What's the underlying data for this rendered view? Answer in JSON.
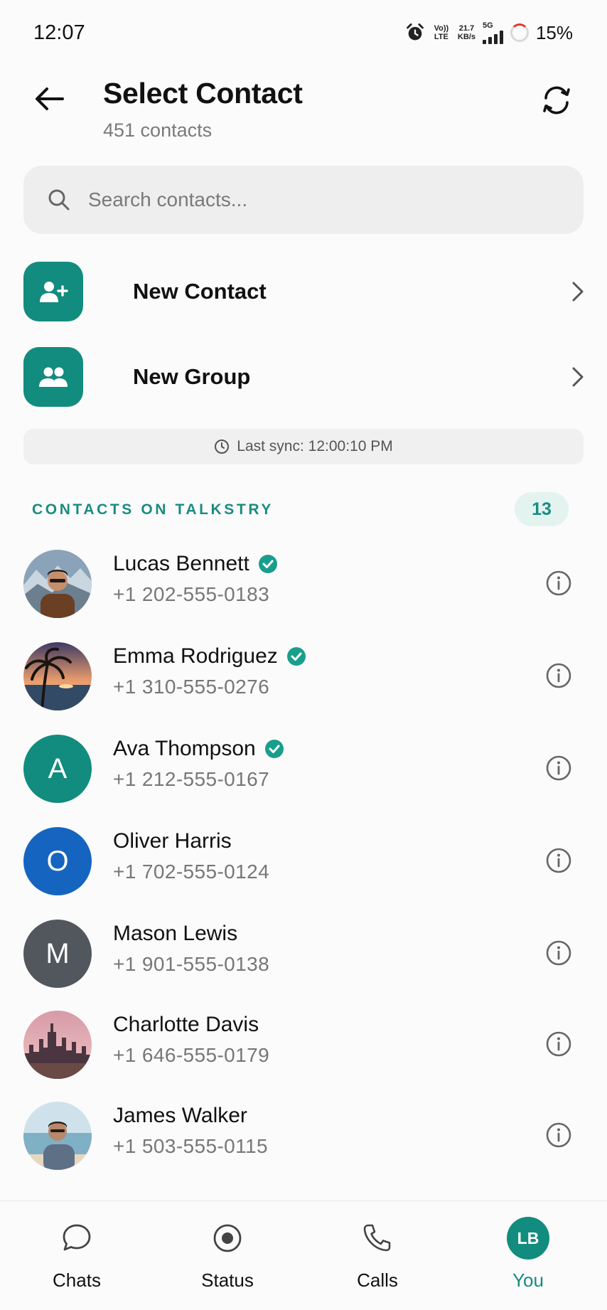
{
  "status_bar": {
    "time": "12:07",
    "volte": "Vo)) LTE",
    "speed_value": "21.7",
    "speed_unit": "KB/s",
    "network": "5G",
    "battery": "15%"
  },
  "header": {
    "title": "Select Contact",
    "subtitle": "451 contacts"
  },
  "search": {
    "placeholder": "Search contacts..."
  },
  "actions": [
    {
      "label": "New Contact",
      "icon": "person-add-icon"
    },
    {
      "label": "New Group",
      "icon": "group-icon"
    }
  ],
  "sync": {
    "text": "Last sync: 12:00:10 PM"
  },
  "section": {
    "title": "CONTACTS ON TALKSTRY",
    "count": "13"
  },
  "contacts": [
    {
      "name": "Lucas Bennett",
      "phone": "+1 202-555-0183",
      "verified": true,
      "avatar": "photo-man-mountains"
    },
    {
      "name": "Emma Rodriguez",
      "phone": "+1 310-555-0276",
      "verified": true,
      "avatar": "photo-palm-sunset"
    },
    {
      "name": "Ava Thompson",
      "phone": "+1 212-555-0167",
      "verified": true,
      "initial": "A",
      "color": "#128c7e"
    },
    {
      "name": "Oliver Harris",
      "phone": "+1 702-555-0124",
      "verified": false,
      "initial": "O",
      "color": "#1565c0"
    },
    {
      "name": "Mason Lewis",
      "phone": "+1 901-555-0138",
      "verified": false,
      "initial": "M",
      "color": "#51575d"
    },
    {
      "name": "Charlotte Davis",
      "phone": "+1 646-555-0179",
      "verified": false,
      "avatar": "photo-city-skyline"
    },
    {
      "name": "James Walker",
      "phone": "+1 503-555-0115",
      "verified": false,
      "avatar": "photo-man-beach"
    }
  ],
  "bottom_nav": {
    "chats": "Chats",
    "status": "Status",
    "calls": "Calls",
    "you": "You",
    "me_initials": "LB"
  },
  "colors": {
    "accent": "#128c7e",
    "verified": "#1a9e8c"
  }
}
